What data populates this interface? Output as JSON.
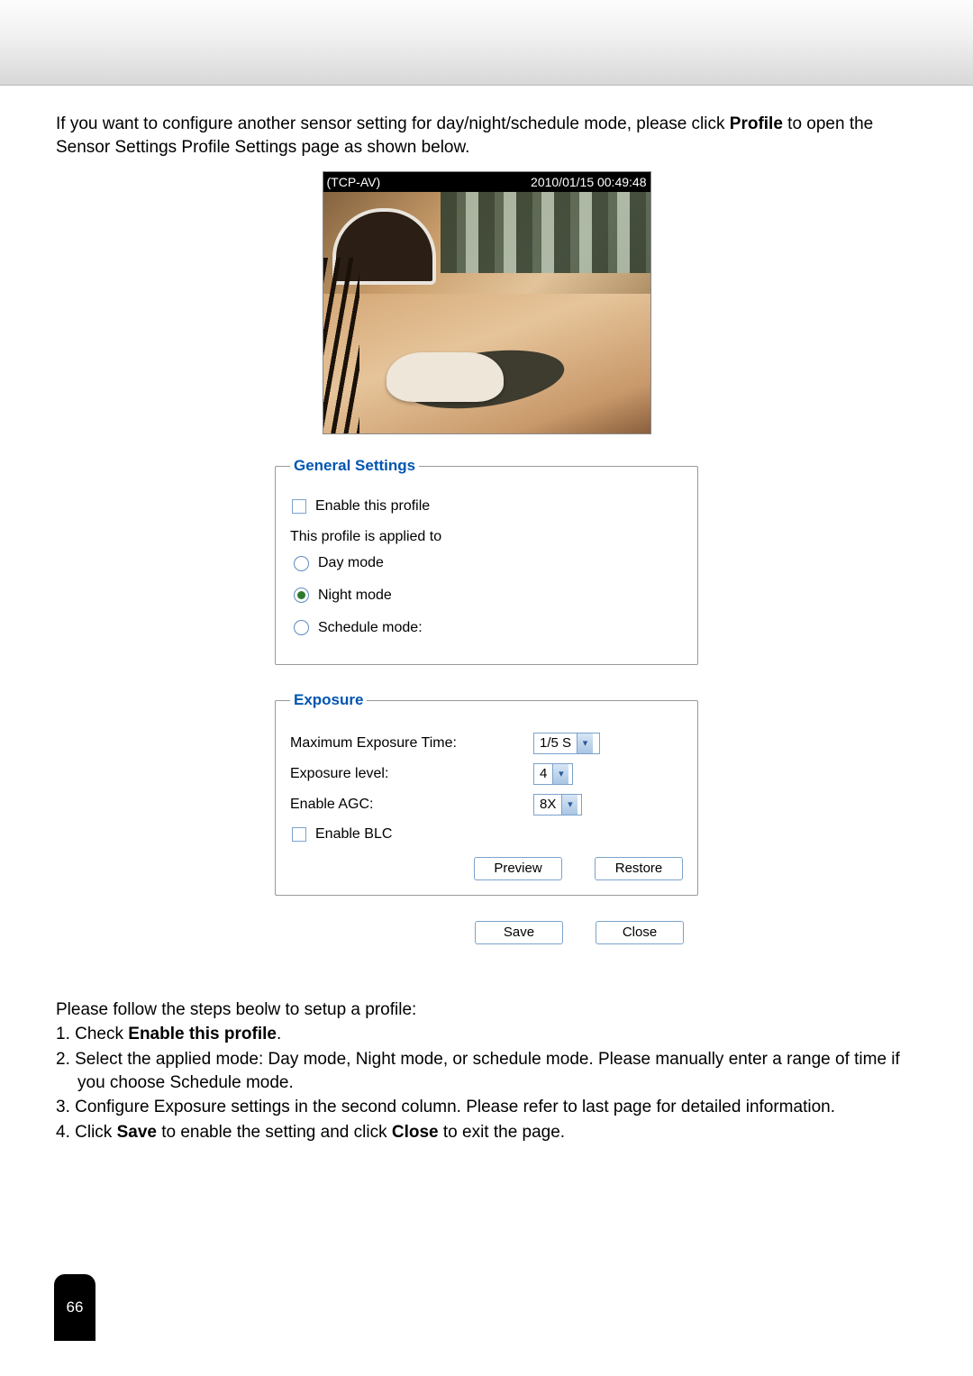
{
  "intro": {
    "prefix": "If you want to configure another sensor setting for day/night/schedule mode, please click ",
    "bold": "Profile",
    "suffix": " to open the Sensor Settings Profile Settings page as shown below."
  },
  "preview": {
    "source_label": "(TCP-AV)",
    "timestamp": "2010/01/15 00:49:48"
  },
  "general": {
    "legend": "General Settings",
    "enable_profile_label": "Enable this profile",
    "applied_to_label": "This profile is applied to",
    "modes": {
      "day": "Day mode",
      "night": "Night mode",
      "schedule": "Schedule mode:"
    },
    "selected_mode": "night"
  },
  "exposure": {
    "legend": "Exposure",
    "max_time_label": "Maximum Exposure Time:",
    "max_time_value": "1/5 S",
    "level_label": "Exposure level:",
    "level_value": "4",
    "agc_label": "Enable AGC:",
    "agc_value": "8X",
    "blc_label": "Enable BLC"
  },
  "buttons": {
    "preview": "Preview",
    "restore": "Restore",
    "save": "Save",
    "close": "Close"
  },
  "instructions": {
    "lead": "Please follow the steps beolw to setup a profile:",
    "step1_prefix": "1. Check ",
    "step1_bold": "Enable this profile",
    "step1_suffix": ".",
    "step2": "2. Select the applied mode: Day mode, Night mode, or schedule mode. Please manually enter a range of time if you choose Schedule mode.",
    "step3": "3. Configure Exposure settings in the second column. Please refer to last page for detailed information.",
    "step4_a": "4. Click ",
    "step4_b": "Save",
    "step4_c": " to enable the setting and click ",
    "step4_d": "Close",
    "step4_e": " to exit the page."
  },
  "page_number": "66"
}
